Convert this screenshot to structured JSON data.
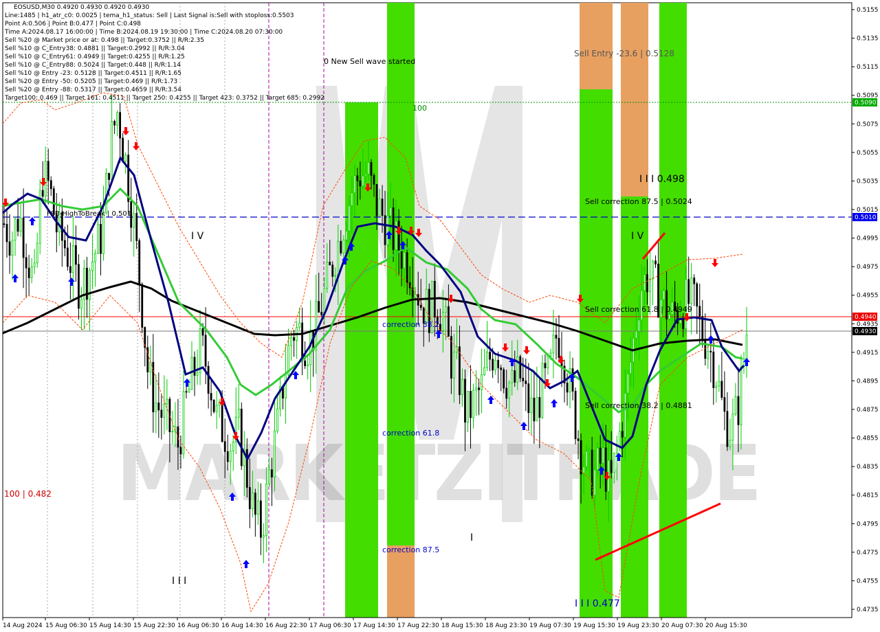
{
  "header": {
    "symbol_line": "EOSUSD,M30  0.4920 0.4930 0.4920 0.4930",
    "info_lines": [
      "Line:1485 | h1_atr_c0: 0.0025 | tema_h1_status: Sell | Last Signal is:Sell with stoploss:0.5503",
      "Point A:0.506 | Point B:0.477 | Point C:0.498",
      "Time A:2024.08.17 16:00:00 | Time B:2024.08.19 19:30:00 | Time C:2024.08.20 07:30:00",
      "Sell %20 @ Market price or at: 0.498 || Target:0.3752 || R/R:2.35",
      "Sell %10 @ C_Entry38: 0.4881 || Target:0.2992 || R/R:3.04",
      "Sell %10 @ C_Entry61: 0.4949 || Target:0.4255 || R/R:1.25",
      "Sell %10 @ C_Entry88: 0.5024 || Target:0.448 || R/R:1.14",
      "Sell %10 @ Entry -23: 0.5128 || Target:0.4511 || R/R:1.65",
      "Sell %20 @ Entry -50: 0.5205 || Target:0.469 || R/R:1.73",
      "Sell %20 @ Entry -88: 0.5317 || Target:0.4659 || R/R:3.54",
      "Target100: 0.469 || Target 161: 0.4511 || Target 250: 0.4255 || Target 423: 0.3752 || Target 685: 0.2992"
    ]
  },
  "annotations": {
    "new_sell_wave": "0 New Sell wave started",
    "label_100": "100",
    "sell_entry": "Sell Entry -23.6 | 0.5128",
    "wave_498": "I I I 0.498",
    "sell_corr_875": "Sell correction 87.5 | 0.5024",
    "sell_corr_618": "Sell correction 61.8 | 0.4949",
    "sell_corr_382": "Sell correction 38.2 | 0.4881",
    "correction_382": "correction 38.2",
    "correction_618": "correction 61.8",
    "correction_875": "correction 87.5",
    "wave_477": "I I I 0.477",
    "fsb": "FSB-HighToBreak | 0.501",
    "left_482": "100 | 0.482",
    "iv_left": "I V",
    "iv_right": "I V",
    "iii_left": "I I I",
    "i_mid": "I",
    "watermark": "MARKETZITRADE"
  },
  "price_badges": {
    "level_5090": "0.5090",
    "level_5010": "0.5010",
    "level_4940": "0.4940",
    "level_4930": "0.4930"
  },
  "colors": {
    "green_zone": "#44dd00",
    "orange_zone": "#e8a060",
    "sma_black": "#000000",
    "ma_blue": "#000080",
    "ma_green": "#33cc33",
    "sell_arrow": "#ff0000",
    "buy_arrow": "#0000ff",
    "level_red": "#ff0000",
    "level_blue": "#0000ff",
    "level_green": "#009900"
  },
  "chart_data": {
    "type": "candlestick",
    "symbol": "EOSUSD",
    "timeframe": "M30",
    "ylim": [
      0.4733,
      0.516
    ],
    "yticks": [
      "0.5155",
      "0.5135",
      "0.5115",
      "0.5095",
      "0.5075",
      "0.5055",
      "0.5035",
      "0.5015",
      "0.4995",
      "0.4975",
      "0.4955",
      "0.4935",
      "0.4915",
      "0.4895",
      "0.4875",
      "0.4855",
      "0.4835",
      "0.4815",
      "0.4795",
      "0.4775",
      "0.4755",
      "0.4735"
    ],
    "xticks": [
      "14 Aug 2024",
      "15 Aug 06:30",
      "15 Aug 14:30",
      "15 Aug 22:30",
      "16 Aug 06:30",
      "16 Aug 14:30",
      "16 Aug 22:30",
      "17 Aug 06:30",
      "17 Aug 14:30",
      "17 Aug 22:30",
      "18 Aug 15:30",
      "18 Aug 23:30",
      "19 Aug 07:30",
      "19 Aug 15:30",
      "19 Aug 23:30",
      "20 Aug 07:30",
      "20 Aug 15:30"
    ],
    "close_path": [
      0.5005,
      0.4995,
      0.5012,
      0.4985,
      0.496,
      0.504,
      0.503,
      0.5,
      0.499,
      0.4975,
      0.496,
      0.497,
      0.4985,
      0.5,
      0.506,
      0.5085,
      0.505,
      0.501,
      0.496,
      0.49,
      0.488,
      0.487,
      0.486,
      0.485,
      0.488,
      0.49,
      0.492,
      0.49,
      0.487,
      0.486,
      0.485,
      0.486,
      0.483,
      0.48,
      0.479,
      0.483,
      0.486,
      0.49,
      0.493,
      0.493,
      0.492,
      0.493,
      0.495,
      0.497,
      0.499,
      0.501,
      0.503,
      0.504,
      0.504,
      0.502,
      0.501,
      0.5,
      0.499,
      0.498,
      0.497,
      0.495,
      0.4945,
      0.495,
      0.494,
      0.491,
      0.49,
      0.487,
      0.488,
      0.489,
      0.491,
      0.492,
      0.49,
      0.489,
      0.49,
      0.488,
      0.487,
      0.489,
      0.49,
      0.493,
      0.491,
      0.488,
      0.485,
      0.483,
      0.483,
      0.484,
      0.482,
      0.485,
      0.488,
      0.492,
      0.496,
      0.497,
      0.496,
      0.495,
      0.494,
      0.4945,
      0.495,
      0.495,
      0.493,
      0.492,
      0.49,
      0.487,
      0.486,
      0.488,
      0.493
    ],
    "levels": [
      0.509,
      0.501,
      0.494,
      0.493
    ]
  }
}
